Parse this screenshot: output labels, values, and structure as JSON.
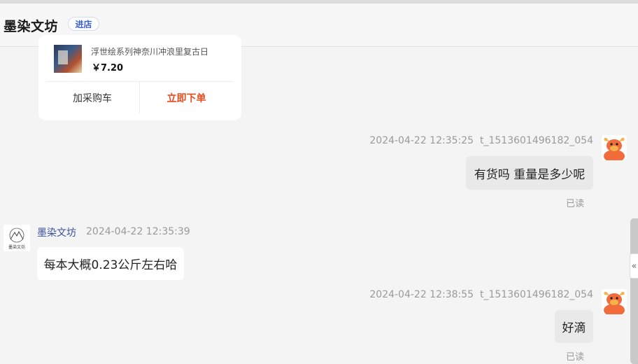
{
  "header": {
    "shop_name": "墨染文坊",
    "enter_shop_label": "进店"
  },
  "product_card": {
    "title": "浮世绘系列神奈川冲浪里复古日",
    "price": "￥7.20",
    "add_to_cart_label": "加采购车",
    "buy_now_label": "立即下单"
  },
  "messages": [
    {
      "direction": "out",
      "timestamp": "2024-04-22 12:35:25",
      "sender": "t_1513601496182_054",
      "text": "有货吗 重量是多少呢",
      "status": "已读"
    },
    {
      "direction": "in",
      "sender": "墨染文坊",
      "timestamp": "2024-04-22 12:35:39",
      "text": "每本大概0.23公斤左右哈"
    },
    {
      "direction": "out",
      "timestamp": "2024-04-22 12:38:55",
      "sender": "t_1513601496182_054",
      "text": "好滴",
      "status": "已读"
    }
  ],
  "shop_avatar_text": "墨染文坊",
  "collapse_glyph": "«",
  "colors": {
    "accent_buy": "#e94b1c",
    "sender_name": "#3c4f9c",
    "enter_btn_text": "#3a5fd0",
    "avatar_orange": "#f26b3a"
  },
  "icons": {
    "user_avatar": "cartoon-bull-avatar-icon",
    "shop_avatar": "mountain-logo-icon",
    "collapse": "double-chevron-left-icon"
  }
}
